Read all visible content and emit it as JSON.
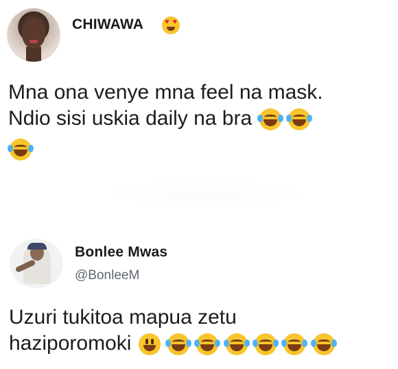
{
  "post1": {
    "author": "CHIWAWA",
    "author_emoji": "heart-eyes-emoji",
    "text_line1": "Mna ona venye mna feel na mask.",
    "text_line2": "Ndio sisi uskia daily na bra",
    "emojis": [
      "tears-of-joy-emoji",
      "tears-of-joy-emoji",
      "tears-of-joy-emoji"
    ]
  },
  "post2": {
    "author": "Bonlee Mwas",
    "handle": "@BonleeM",
    "text_line1": "Uzuri tukitoa mapua zetu",
    "text_line2": "haziporomoki",
    "emojis": [
      "grinning-emoji",
      "tears-of-joy-emoji",
      "tears-of-joy-emoji",
      "tears-of-joy-emoji",
      "tears-of-joy-emoji",
      "tears-of-joy-emoji",
      "tears-of-joy-emoji"
    ]
  },
  "colors": {
    "background": "#ffffff",
    "text": "#1c1c1c",
    "handle": "#606770",
    "emoji_yellow": "#f7c52c",
    "tear_blue": "#4fb3f0"
  }
}
